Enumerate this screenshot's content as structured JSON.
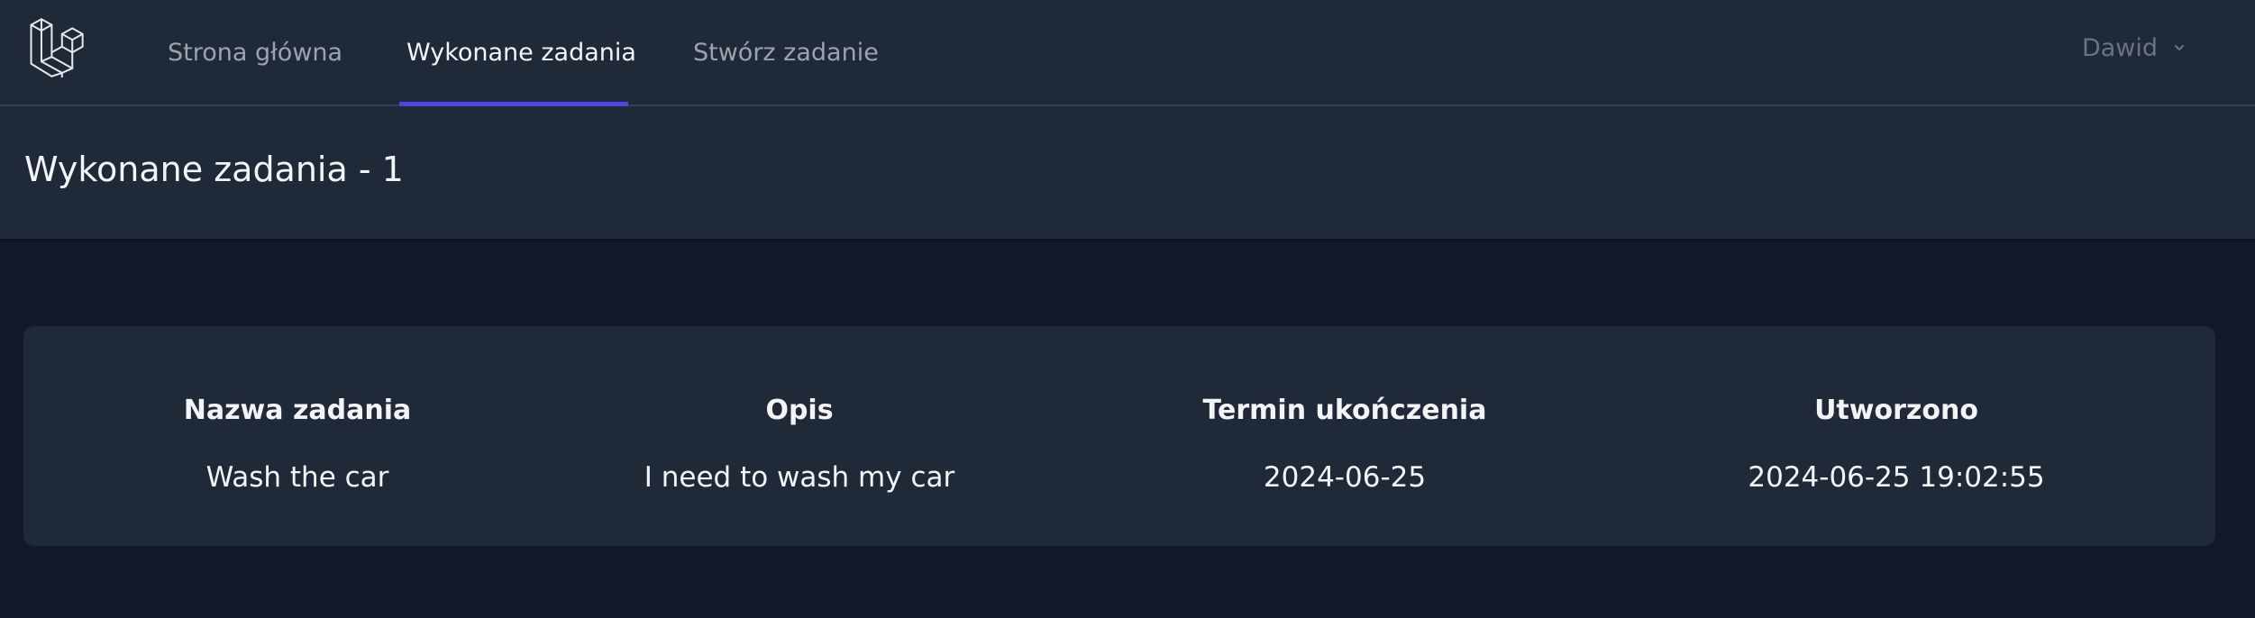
{
  "nav": {
    "logo_icon": "laravel-logo-icon",
    "links": [
      {
        "label": "Strona główna",
        "active": false
      },
      {
        "label": "Wykonane zadania",
        "active": true
      },
      {
        "label": "Stwórz zadanie",
        "active": false
      }
    ],
    "user": {
      "name": "Dawid",
      "icon": "chevron-down-icon"
    },
    "accent_color": "#4f46e5"
  },
  "header": {
    "title": "Wykonane zadania - 1"
  },
  "table": {
    "columns": [
      "Nazwa zadania",
      "Opis",
      "Termin ukończenia",
      "Utworzono"
    ],
    "rows": [
      [
        "Wash the car",
        "I need to wash my car",
        "2024-06-25",
        "2024-06-25 19:02:55"
      ]
    ]
  },
  "colors": {
    "page_background": "#111827",
    "panel_background": "#1f2937",
    "text_primary": "#f3f4f6",
    "text_muted": "#9ca3af"
  }
}
